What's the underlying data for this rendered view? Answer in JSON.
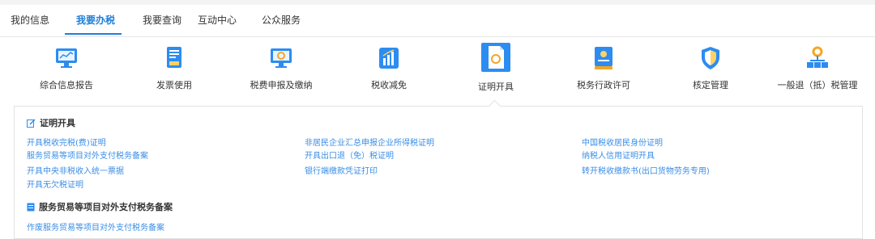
{
  "tabs": [
    "我的信息",
    "我要办税",
    "我要查询",
    "互动中心",
    "公众服务"
  ],
  "active_tab_index": 1,
  "icon_nav": [
    {
      "label": "综合信息报告",
      "icon": "monitor-chart-icon"
    },
    {
      "label": "发票使用",
      "icon": "invoice-document-icon"
    },
    {
      "label": "税费申报及缴纳",
      "icon": "monitor-gear-icon"
    },
    {
      "label": "税收减免",
      "icon": "bar-chart-icon"
    },
    {
      "label": "证明开具",
      "icon": "certificate-document-icon"
    },
    {
      "label": "税务行政许可",
      "icon": "license-icon"
    },
    {
      "label": "核定管理",
      "icon": "shield-icon"
    },
    {
      "label": "一般退（抵）税管理",
      "icon": "org-chart-icon"
    }
  ],
  "active_icon_index": 4,
  "sections": [
    {
      "title": "证明开具",
      "columns": [
        [
          "开具税收完税(费)证明",
          "服务贸易等项目对外支付税务备案",
          "开具中央非税收入统一票据",
          "开具无欠税证明"
        ],
        [
          "非居民企业汇总申报企业所得税证明",
          "开具出口退（免）税证明",
          "银行端缴款凭证打印"
        ],
        [
          "中国税收居民身份证明",
          "纳税人信用证明开具",
          "转开税收缴款书(出口货物劳务专用)"
        ]
      ]
    },
    {
      "title": "服务贸易等项目对外支付税务备案",
      "columns": [
        [
          "作废服务贸易等项目对外支付税务备案"
        ]
      ]
    }
  ],
  "colors": {
    "accent": "#1f7ed8",
    "link": "#3a8ee6"
  }
}
